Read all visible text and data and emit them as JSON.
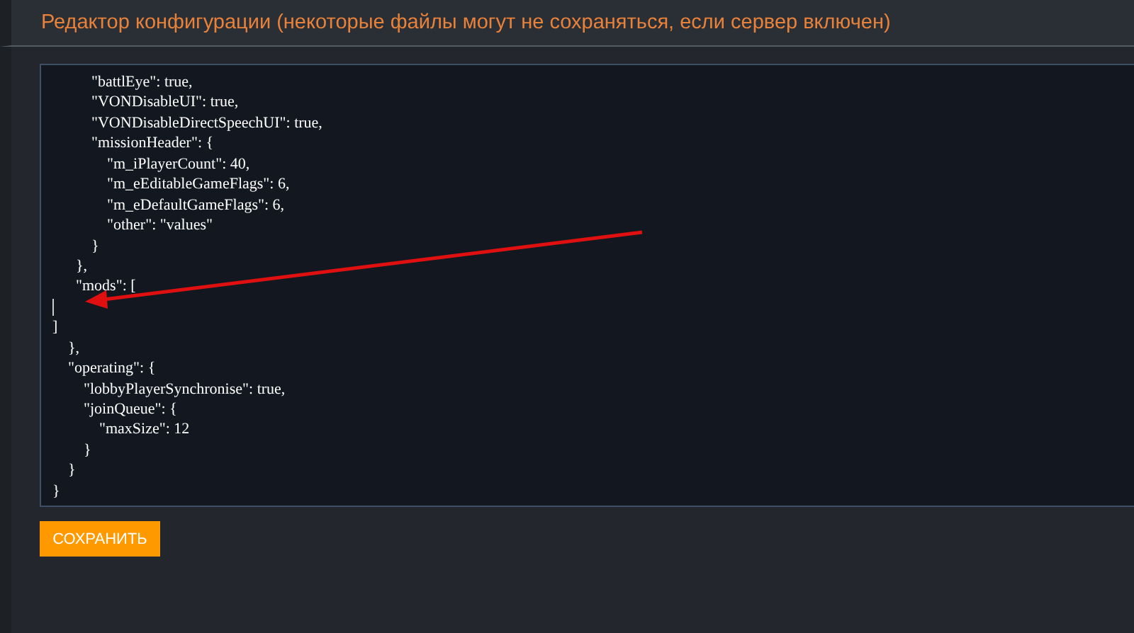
{
  "title": "Редактор конфигурации (некоторые файлы могут не сохраняться, если сервер включен)",
  "editor": {
    "lines": [
      {
        "text": "          \"battlEye\": true,"
      },
      {
        "text": "          \"VONDisableUI\": true,"
      },
      {
        "text": "          \"VONDisableDirectSpeechUI\": true,"
      },
      {
        "text": "          \"missionHeader\": {"
      },
      {
        "text": "              \"m_iPlayerCount\": 40,"
      },
      {
        "text": "              \"m_eEditableGameFlags\": 6,"
      },
      {
        "text": "              \"m_eDefaultGameFlags\": 6,"
      },
      {
        "text": "              \"other\": \"values\""
      },
      {
        "text": "          }"
      },
      {
        "text": "      },"
      },
      {
        "text": "      \"mods\": ["
      },
      {
        "caret": true
      },
      {
        "text": "]"
      },
      {
        "text": "    },"
      },
      {
        "text": "    \"operating\": {"
      },
      {
        "text": "        \"lobbyPlayerSynchronise\": true,"
      },
      {
        "text": "        \"joinQueue\": {"
      },
      {
        "text": "            \"maxSize\": 12"
      },
      {
        "text": "        }"
      },
      {
        "text": "    }"
      },
      {
        "text": "}"
      }
    ]
  },
  "save_button": "СОХРАНИТЬ"
}
